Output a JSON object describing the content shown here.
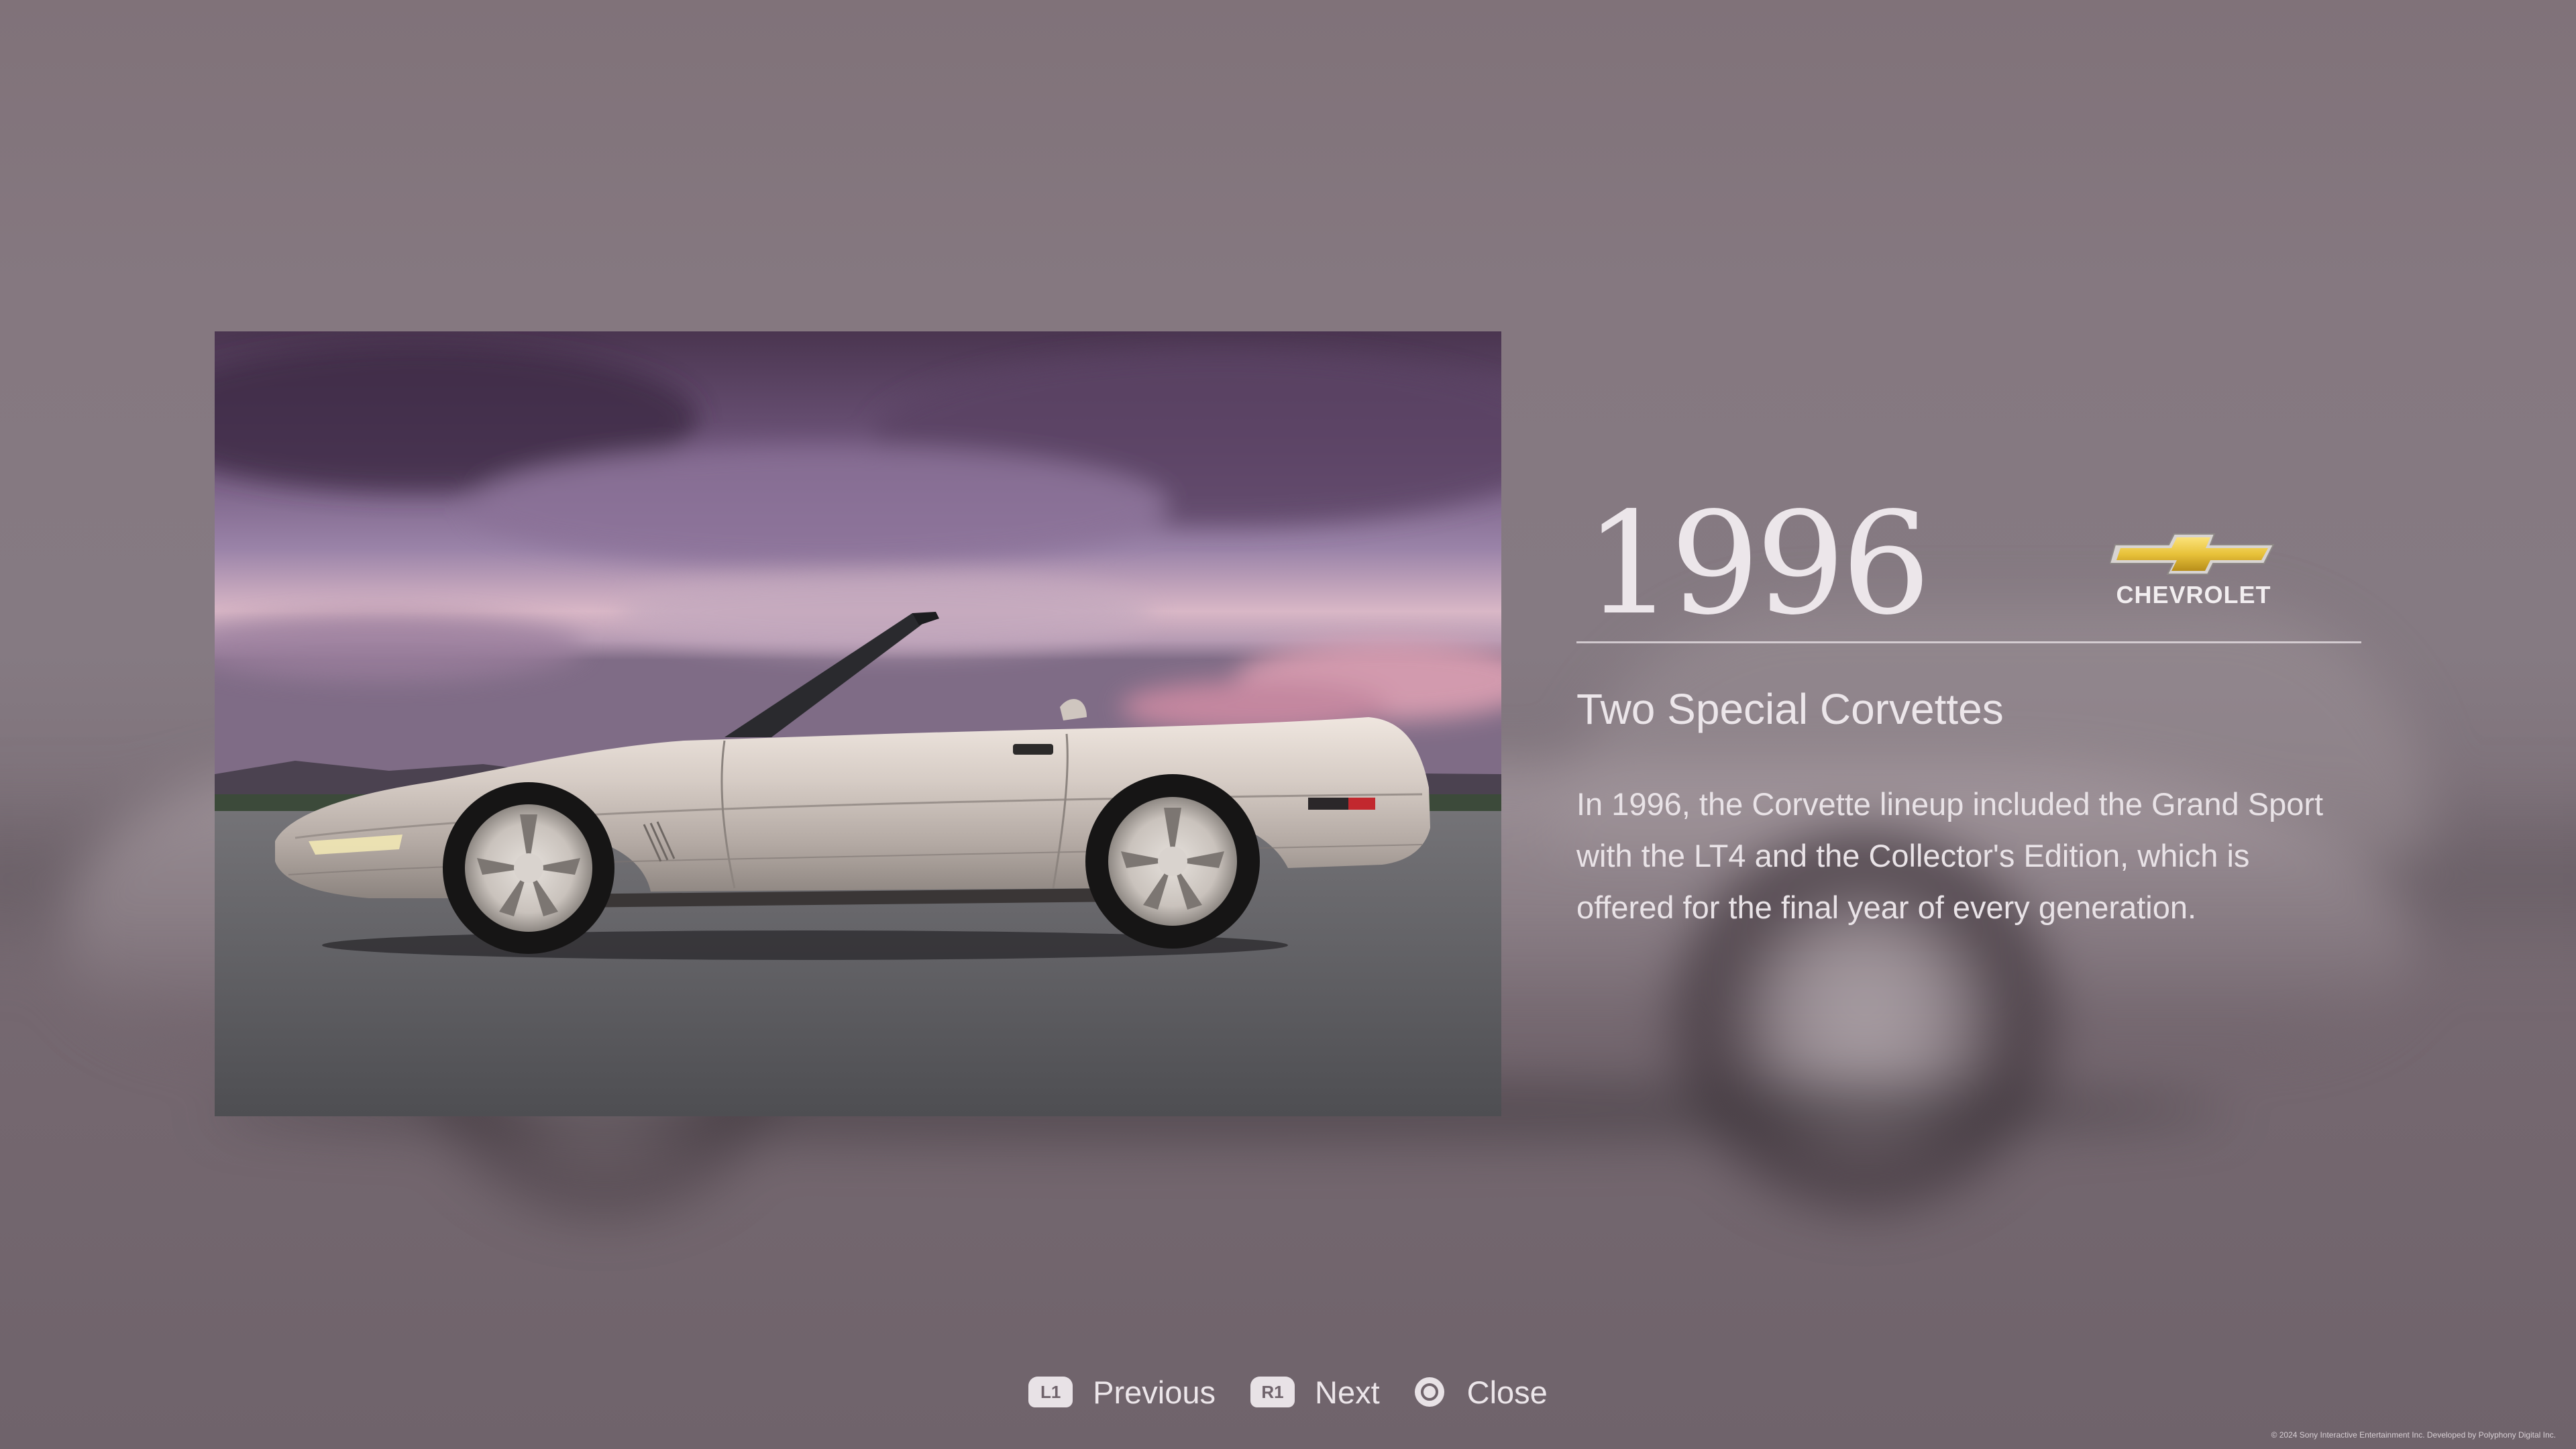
{
  "article": {
    "year": "1996",
    "brand": "CHEVROLET",
    "title": "Two Special Corvettes",
    "body": "In 1996, the Corvette lineup included the Grand Sport with the LT4 and the Collector's Edition, which is offered for the final year of every generation."
  },
  "controls": {
    "previous": {
      "button": "L1",
      "label": "Previous"
    },
    "next": {
      "button": "R1",
      "label": "Next"
    },
    "close": {
      "button": "circle-icon",
      "label": "Close"
    }
  },
  "footer": {
    "copyright": "© 2024 Sony Interactive Entertainment Inc. Developed by Polyphony Digital Inc."
  },
  "colors": {
    "background": "#7e717a",
    "text": "#ece6ea",
    "logo_gold": "#e8c23a"
  }
}
